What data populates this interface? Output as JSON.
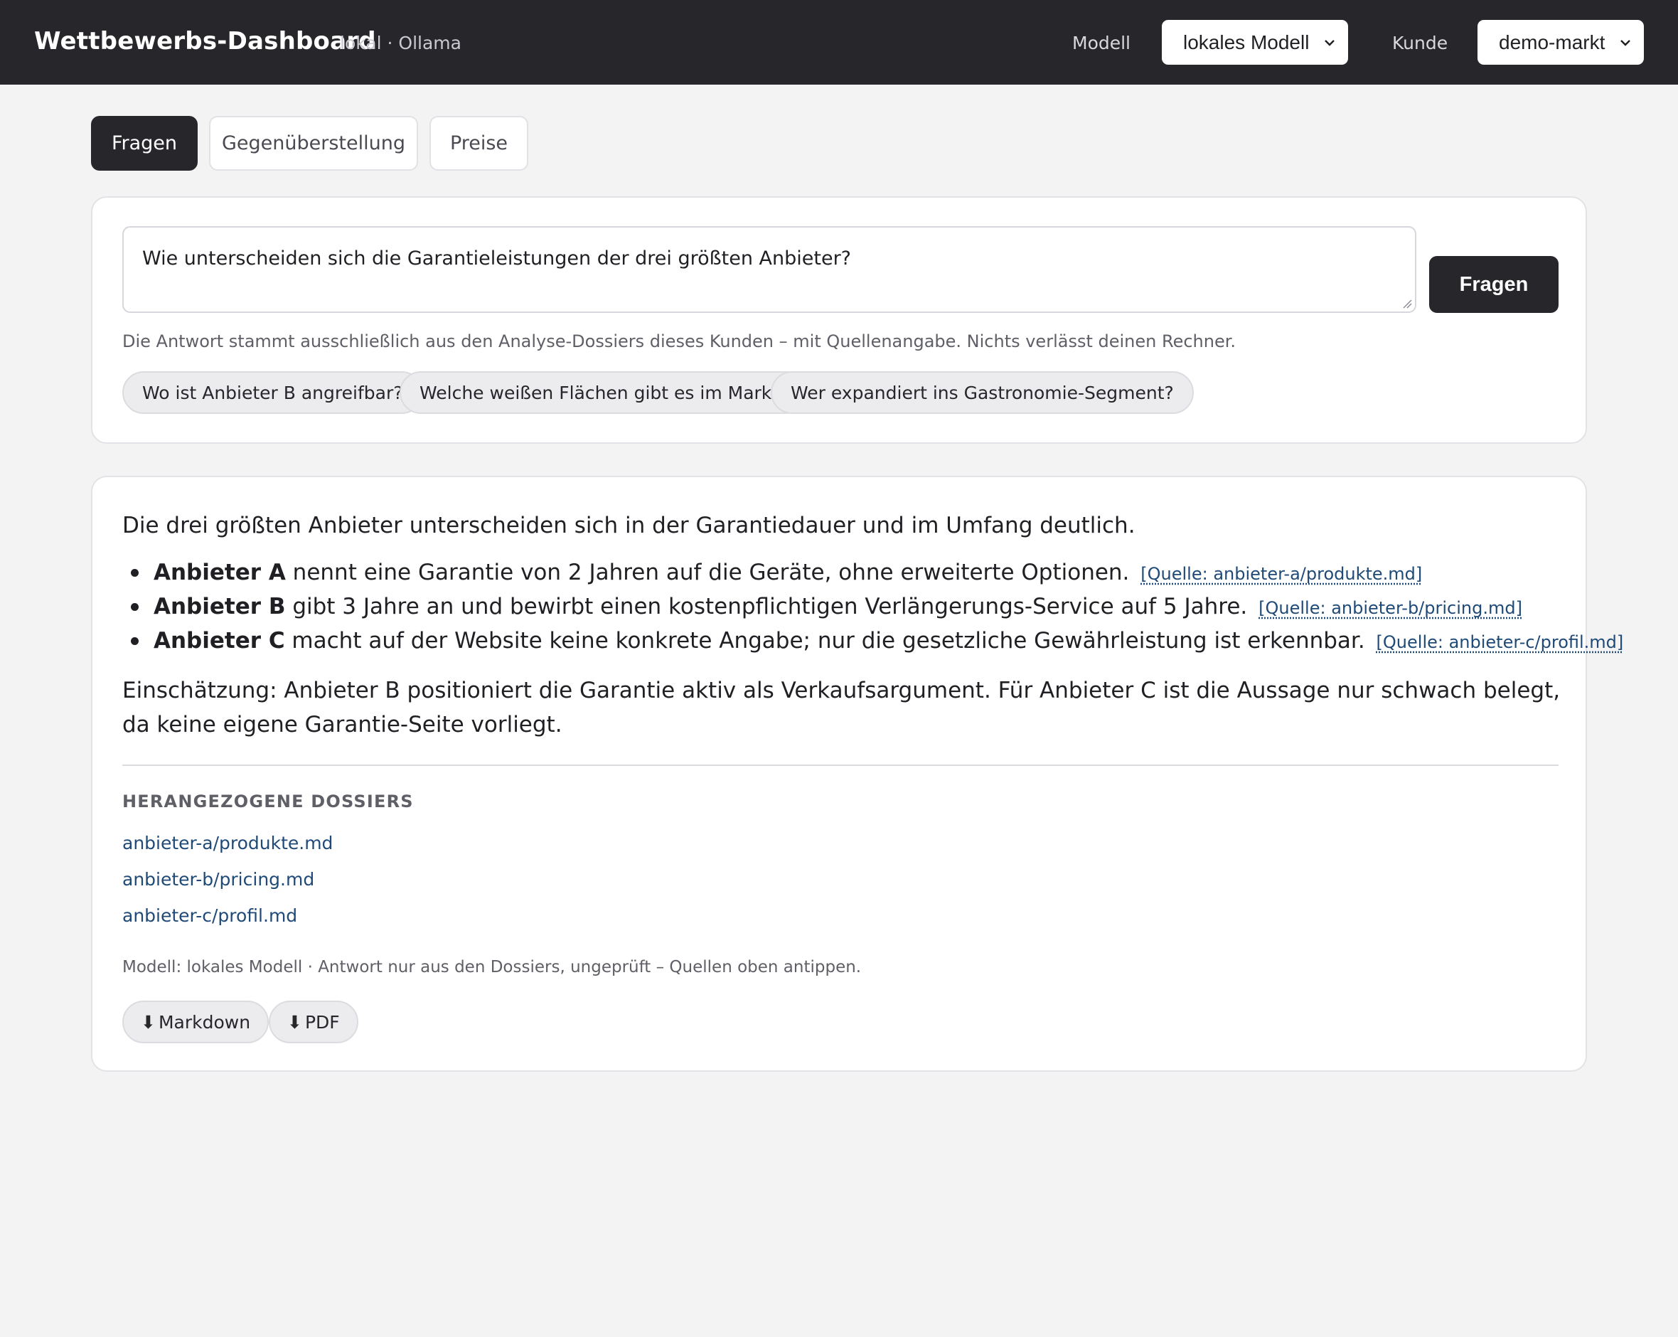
{
  "header": {
    "title": "Wettbewerbs-Dashboard",
    "subtitle": "lokal · Ollama",
    "model_label": "Modell",
    "model_value": "lokales Modell",
    "customer_label": "Kunde",
    "customer_value": "demo-markt"
  },
  "tabs": [
    {
      "label": "Fragen",
      "active": true
    },
    {
      "label": "Gegenüberstellung",
      "active": false
    },
    {
      "label": "Preise",
      "active": false
    }
  ],
  "question": {
    "input_value": "Wie unterscheiden sich die Garantieleistungen der drei größten Anbieter?",
    "submit_label": "Fragen",
    "hint": "Die Antwort stammt ausschließlich aus den Analyse-Dossiers dieses Kunden – mit Quellenangabe. Nichts verlässt deinen Rechner.",
    "suggestions": [
      "Wo ist Anbieter B angreifbar?",
      "Welche weißen Flächen gibt es im Markt?",
      "Wer expandiert ins Gastronomie-Segment?"
    ]
  },
  "answer": {
    "intro": "Die drei größten Anbieter unterscheiden sich in der Garantiedauer und im Umfang deutlich.",
    "bullets": [
      {
        "name": "Anbieter A",
        "text": " nennt eine Garantie von 2 Jahren auf die Geräte, ohne erweiterte Optionen.",
        "source": "[Quelle: anbieter-a/produkte.md]"
      },
      {
        "name": "Anbieter B",
        "text": " gibt 3 Jahre an und bewirbt einen kostenpflichtigen Verlängerungs-Service auf 5 Jahre.",
        "source": "[Quelle: anbieter-b/pricing.md]"
      },
      {
        "name": "Anbieter C",
        "text": " macht auf der Website keine konkrete Angabe; nur die gesetzliche Gewährleistung ist erkennbar.",
        "source": "[Quelle: anbieter-c/profil.md]"
      }
    ],
    "assessment": "Einschätzung: Anbieter B positioniert die Garantie aktiv als Verkaufsargument. Für Anbieter C ist die Aussage nur schwach belegt, da keine eigene Garantie-Seite vorliegt.",
    "dossiers_heading": "HERANGEZOGENE DOSSIERS",
    "dossiers": [
      "anbieter-a/produkte.md",
      "anbieter-b/pricing.md",
      "anbieter-c/profil.md"
    ],
    "meta": "Modell: lokales Modell · Antwort nur aus den Dossiers, ungeprüft – Quellen oben antippen.",
    "downloads": [
      {
        "icon": "download-arrow-icon",
        "label": "Markdown"
      },
      {
        "icon": "download-arrow-icon",
        "label": "PDF"
      }
    ]
  },
  "colors": {
    "header_bg": "#26262b",
    "page_bg": "#f3f3f3",
    "link": "#1f4a78",
    "chip_bg": "#ececef"
  }
}
